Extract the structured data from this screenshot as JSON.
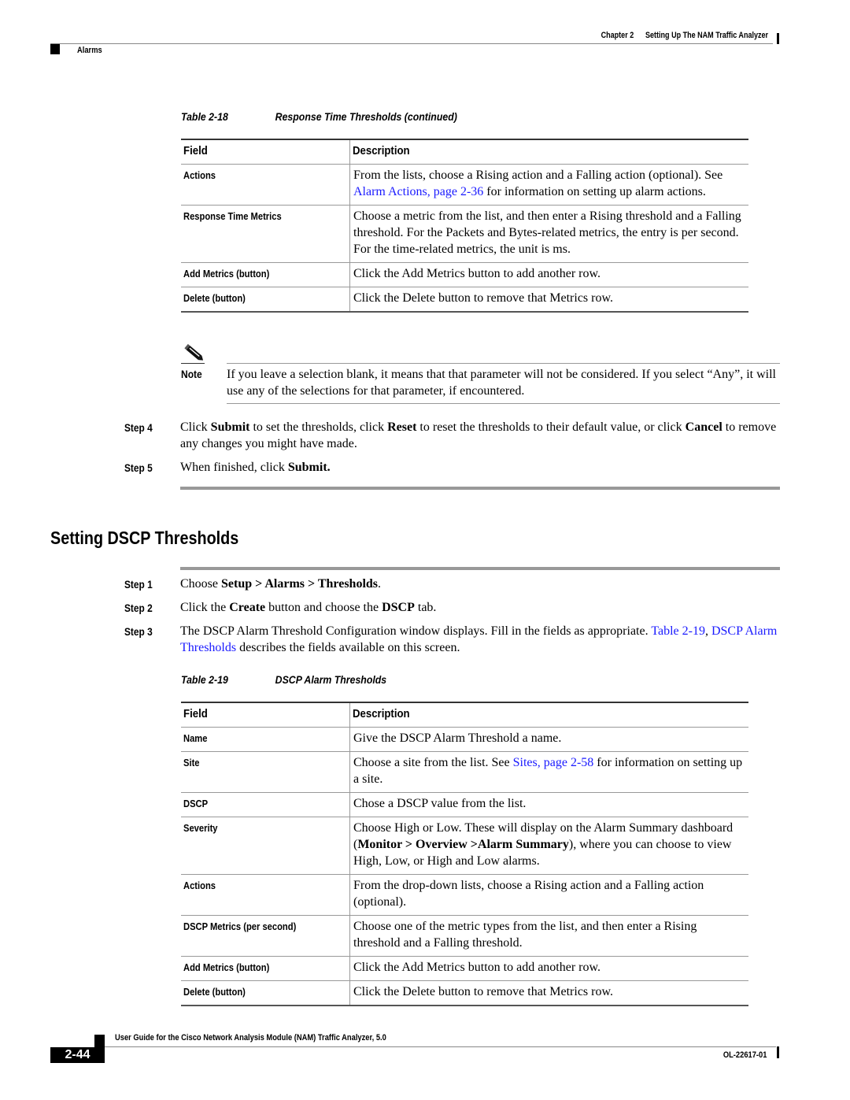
{
  "header": {
    "chapter_label": "Chapter 2",
    "chapter_title": "Setting Up The NAM Traffic Analyzer",
    "section": "Alarms"
  },
  "table18": {
    "caption_number": "Table 2-18",
    "caption_title": "Response Time Thresholds (continued)",
    "col_field": "Field",
    "col_description": "Description",
    "rows": [
      {
        "field": "Actions",
        "desc_before": "From the lists, choose a Rising action and a Falling action (optional). See ",
        "link": "Alarm Actions, page 2-36",
        "desc_after": " for information on setting up alarm actions."
      },
      {
        "field": "Response Time Metrics",
        "desc": "Choose a metric from the list, and then enter a Rising threshold and a Falling threshold. For the Packets and Bytes-related metrics, the entry is per second. For the time-related metrics, the unit is ms."
      },
      {
        "field": "Add Metrics (button)",
        "desc": "Click the Add Metrics button to add another row."
      },
      {
        "field": "Delete (button)",
        "desc": "Click the Delete button to remove that Metrics row."
      }
    ]
  },
  "note": {
    "icon": "pencil-note-icon",
    "label": "Note",
    "text": "If you leave a selection blank, it means that that parameter will not be considered. If you select “Any”, it will use any of the selections for that parameter, if encountered."
  },
  "steps_a": [
    {
      "label": "Step 4",
      "p1": "Click ",
      "b1": "Submit",
      "p2": " to set the thresholds, click ",
      "b2": "Reset",
      "p3": " to reset the thresholds to their default value, or click ",
      "b3": "Cancel",
      "p4": " to remove any changes you might have made."
    },
    {
      "label": "Step 5",
      "p1": "When finished, click ",
      "b1": "Submit."
    }
  ],
  "section": {
    "heading": "Setting DSCP Thresholds"
  },
  "steps_b": [
    {
      "label": "Step 1",
      "p1": "Choose ",
      "b1": "Setup > Alarms > Thresholds",
      "p2": "."
    },
    {
      "label": "Step 2",
      "p1": "Click the ",
      "b1": "Create",
      "p2": " button and choose the ",
      "b2": "DSCP",
      "p3": " tab."
    },
    {
      "label": "Step 3",
      "p1": "The DSCP Alarm Threshold Configuration window displays. Fill in the fields as appropriate. ",
      "link1": "Table 2-19",
      "p2": ", ",
      "link2": "DSCP Alarm Thresholds",
      "p3": " describes the fields available on this screen."
    }
  ],
  "table19": {
    "caption_number": "Table 2-19",
    "caption_title": "DSCP Alarm Thresholds",
    "col_field": "Field",
    "col_description": "Description",
    "rows": [
      {
        "field": "Name",
        "desc": "Give the DSCP Alarm Threshold a name."
      },
      {
        "field": "Site",
        "desc_before": "Choose a site from the list. See ",
        "link": "Sites, page 2-58",
        "desc_after": " for information on setting up a site."
      },
      {
        "field": "DSCP",
        "desc": "Chose a DSCP value from the list."
      },
      {
        "field": "Severity",
        "desc_before": "Choose High or Low. These will display on the Alarm Summary dashboard (",
        "bold": "Monitor > Overview >Alarm Summary",
        "desc_after": "), where you can choose to view High, Low, or High and Low alarms."
      },
      {
        "field": "Actions",
        "desc": "From the drop-down lists, choose a Rising action and a Falling action (optional)."
      },
      {
        "field": "DSCP Metrics (per second)",
        "desc": "Choose one of the metric types from the list, and then enter a Rising threshold and a Falling threshold."
      },
      {
        "field": "Add Metrics (button)",
        "desc": "Click the Add Metrics button to add another row."
      },
      {
        "field": "Delete (button)",
        "desc": "Click the Delete button to remove that Metrics row."
      }
    ]
  },
  "footer": {
    "title": "User Guide for the Cisco Network Analysis Module (NAM) Traffic Analyzer, 5.0",
    "page_number": "2-44",
    "doc_number": "OL-22617-01"
  },
  "colors": {
    "link": "#1a1aff",
    "rule": "#999999",
    "text": "#000000"
  }
}
